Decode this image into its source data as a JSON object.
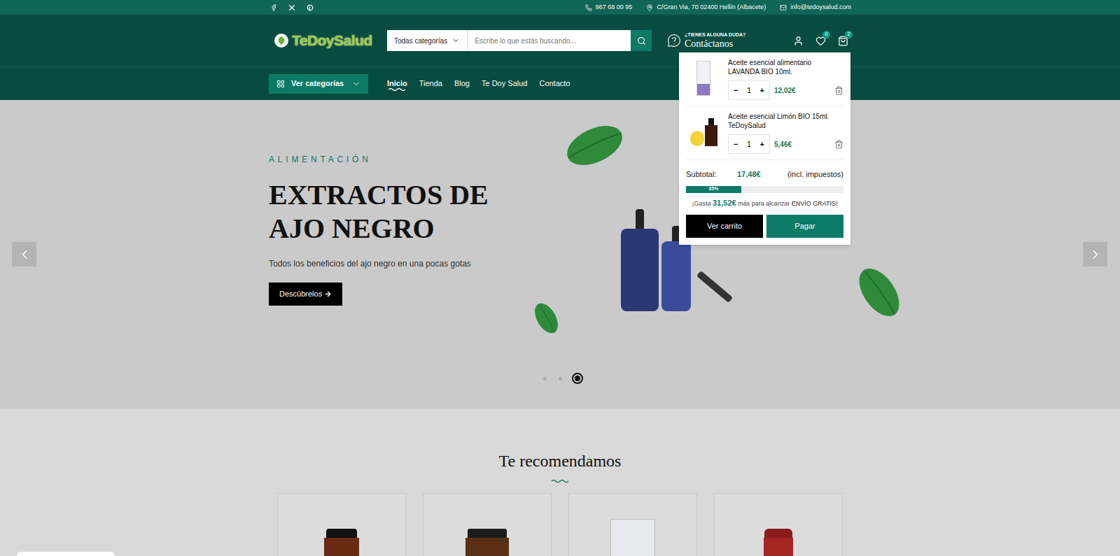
{
  "topbar": {
    "phone": "967 68 00 95",
    "address": "C/Gran Via, 70 02400 Hellín (Albacete)",
    "email": "info@tedoysalud.com"
  },
  "header": {
    "logo": "TeDoySalud",
    "search": {
      "category": "Todas categorías",
      "placeholder": "Escribe lo que estás buscando..."
    },
    "contact": {
      "question": "¿TIENES ALGUNA DUDA?",
      "label": "Contáctanos"
    },
    "wishlist_count": "0",
    "cart_count": "2"
  },
  "nav": {
    "categories_button": "Ver categorías",
    "links": [
      {
        "label": "Inicio",
        "selected": true
      },
      {
        "label": "Tienda",
        "selected": false
      },
      {
        "label": "Blog",
        "selected": false
      },
      {
        "label": "Te Doy Salud",
        "selected": false
      },
      {
        "label": "Contacto",
        "selected": false
      }
    ]
  },
  "hero": {
    "eyebrow": "ALIMENTACIÓN",
    "title": "EXTRACTOS DE AJO NEGRO",
    "subtitle": "Todos los beneficios del ajo negro en una pocas gotas",
    "button": "Descúbrelos",
    "dots": [
      {
        "selected": false
      },
      {
        "selected": false
      },
      {
        "selected": true
      }
    ]
  },
  "recommended": {
    "title": "Te recomendamos",
    "cards": [
      {
        "kind": "bottle"
      },
      {
        "kind": "jar"
      },
      {
        "kind": "box"
      },
      {
        "kind": "can"
      }
    ]
  },
  "cart": {
    "minus": "−",
    "plus": "+",
    "items": [
      {
        "name": "Aceite esencial alimentario LAVANDA BIO 10ml.",
        "quantity": "1",
        "price": "12,02€",
        "kind": "lavender"
      },
      {
        "name": "Aceite esencial Limón BIO 15ml. TeDoySalud",
        "quantity": "1",
        "price": "5,46€",
        "kind": "lemon"
      }
    ],
    "subtotal_label": "Subtotal:",
    "subtotal": "17,48€",
    "tax_note": "(incl. impuestos)",
    "progress": {
      "level": 0.35,
      "label": "35%"
    },
    "shipping_message": {
      "before": "¡Gasta ",
      "amount": "31,52€",
      "middle": " más para alcanzar ",
      "highlight": "ENVÍO GRATIS!"
    },
    "buttons": {
      "view": "Ver carrito",
      "checkout": "Pagar"
    }
  }
}
